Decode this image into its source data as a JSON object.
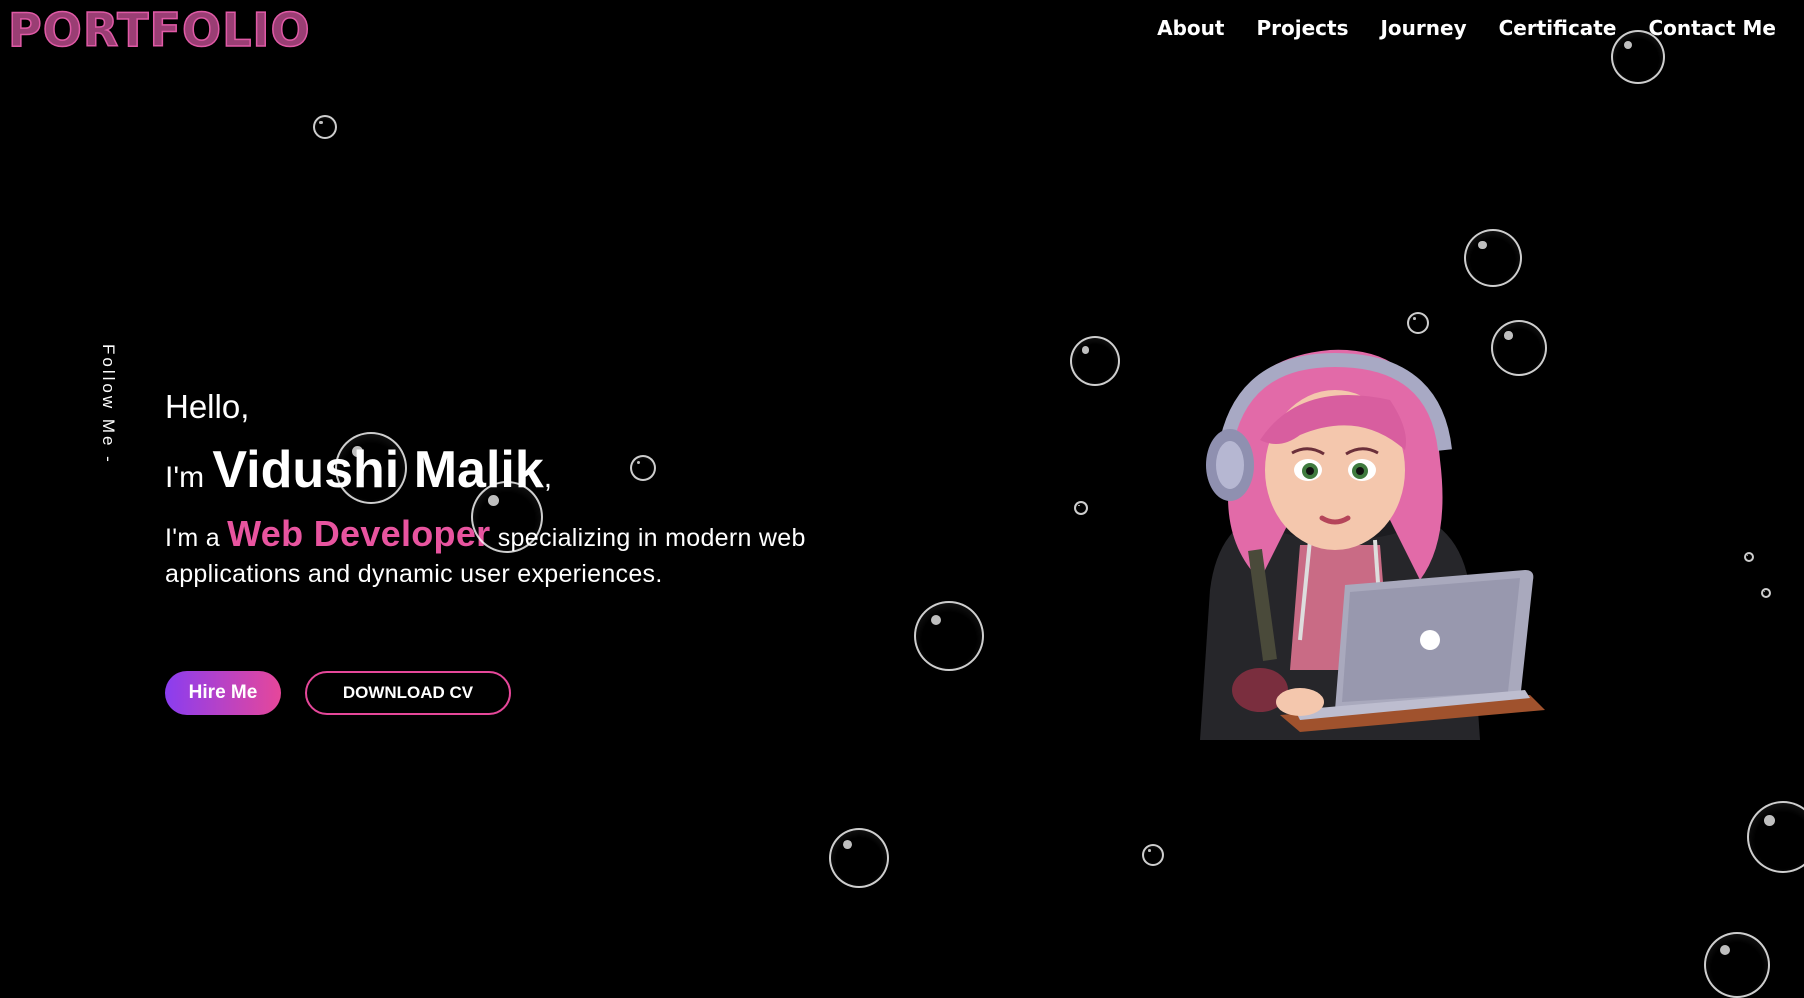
{
  "header": {
    "logo": "PORTFOLIO",
    "nav": [
      "About",
      "Projects",
      "Journey",
      "Certificate",
      "Contact Me"
    ]
  },
  "sidebar": {
    "follow_label": "Follow Me -"
  },
  "hero": {
    "greeting": "Hello,",
    "intro_prefix": "I'm",
    "name": "Vidushi Malik",
    "intro_suffix": ",",
    "role_prefix": "I'm a",
    "role": "Web Developer",
    "role_suffix": "specializing in modern web applications and dynamic user experiences."
  },
  "actions": {
    "hire_label": "Hire Me",
    "cv_label": "DOWNLOAD CV"
  },
  "colors": {
    "accent": "#e6479a",
    "purple": "#8a3df0",
    "logo": "#9a3e74",
    "background": "#000000"
  },
  "illustration": {
    "icon": "developer-avatar-illustration"
  }
}
